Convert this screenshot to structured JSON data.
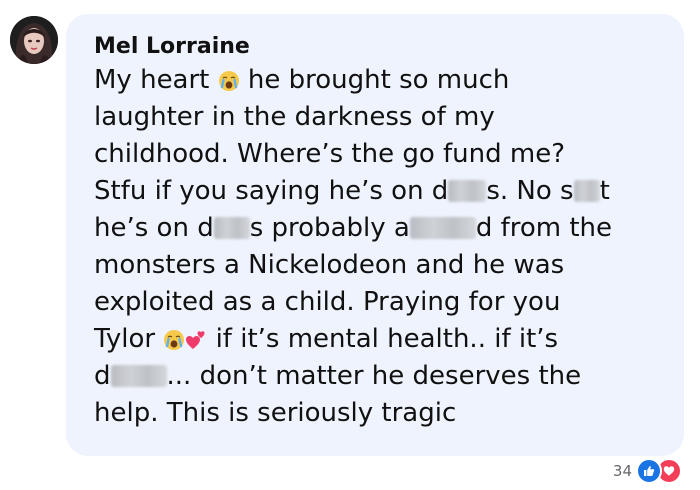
{
  "comment": {
    "author": "Mel Lorraine",
    "lines": [
      [
        "My heart ",
        "EMOJI_CRY",
        " he brought so much"
      ],
      [
        "laughter in the darkness of my"
      ],
      [
        "childhood. Where’s the go fund me?"
      ],
      [
        "Stfu if you saying he’s on d",
        "BLUR_38",
        "s. No s",
        "BLUR_26",
        "t"
      ],
      [
        "he’s on d",
        "BLUR_36",
        "s probably a",
        "BLUR_66",
        "d from the"
      ],
      [
        "monsters a Nickelodeon and he was"
      ],
      [
        "exploited as a child. Praying for you"
      ],
      [
        "Tylor ",
        "EMOJI_CRY",
        "EMOJI_HEARTS",
        " if it’s mental health.. if it’s"
      ],
      [
        "d",
        "BLUR_56",
        "... don’t matter he deserves the"
      ],
      [
        "help. This is seriously tragic"
      ]
    ]
  },
  "reactions": {
    "count": "34",
    "icons": [
      "like-icon",
      "love-icon"
    ]
  },
  "colors": {
    "bubble": "#eef3fd",
    "text": "#111111",
    "like": "#1b74e4",
    "love": "#f33e58"
  }
}
